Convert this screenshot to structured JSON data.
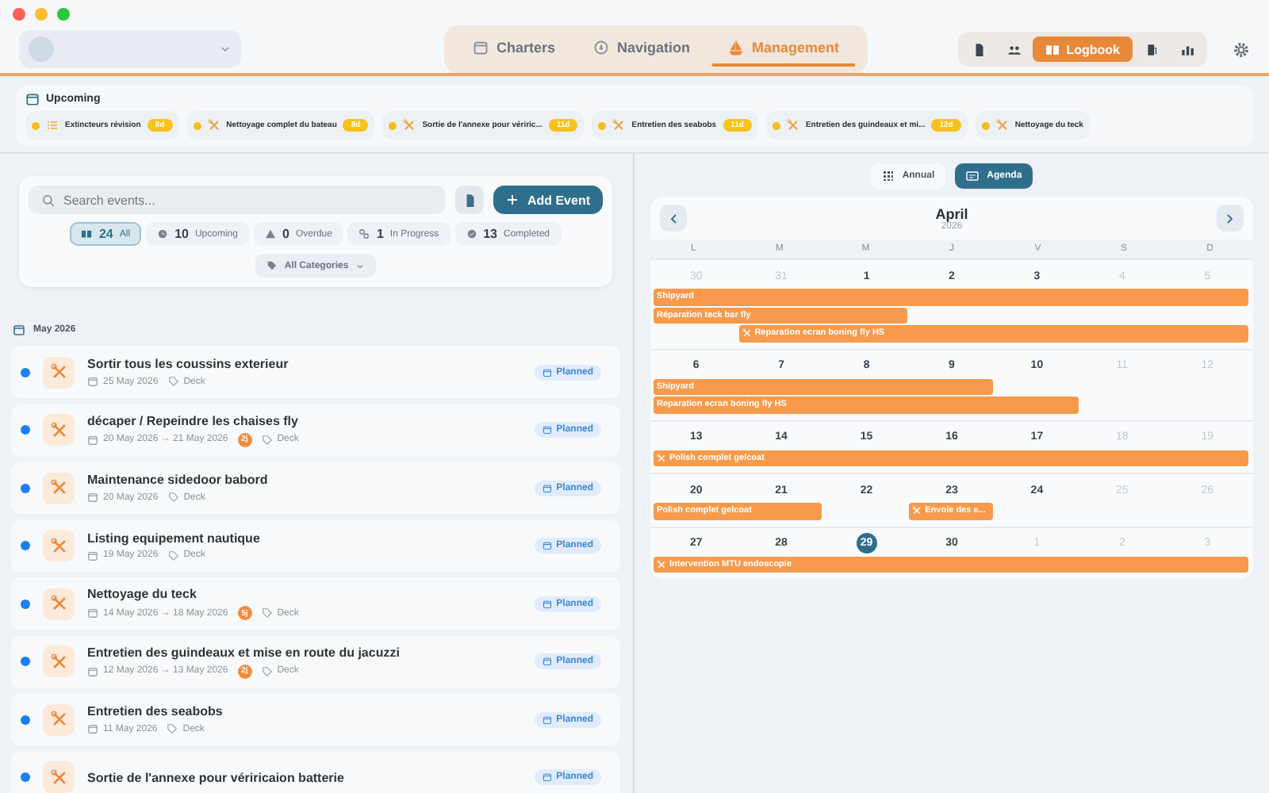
{
  "top_nav": {
    "tabs": [
      {
        "label": "Charters",
        "selected": false
      },
      {
        "label": "Navigation",
        "selected": false
      },
      {
        "label": "Management",
        "selected": true
      }
    ],
    "tools": [
      {
        "kind": "icon",
        "selected": false
      },
      {
        "kind": "icon",
        "selected": false
      },
      {
        "kind": "label",
        "label": "Logbook",
        "selected": true
      },
      {
        "kind": "icon",
        "selected": false
      },
      {
        "kind": "icon",
        "selected": false
      }
    ]
  },
  "upcoming": {
    "title": "Upcoming",
    "items": [
      {
        "kind": "checklist",
        "title": "Extincteurs révision",
        "days": "8d"
      },
      {
        "kind": "maintenance",
        "title": "Nettoyage complet du bateau",
        "days": "8d"
      },
      {
        "kind": "maintenance",
        "title": "Sortie de l'annexe pour vériric...",
        "days": "11d"
      },
      {
        "kind": "maintenance",
        "title": "Entretien des seabobs",
        "days": "11d"
      },
      {
        "kind": "maintenance",
        "title": "Entretien des guindeaux et mi...",
        "days": "12d"
      },
      {
        "kind": "maintenance",
        "title": "Nettoyage du teck"
      }
    ]
  },
  "search": {
    "placeholder": "Search events..."
  },
  "add_button": "Add Event",
  "filters": [
    {
      "count": "24",
      "label": "All",
      "selected": true
    },
    {
      "count": "10",
      "label": "Upcoming",
      "selected": false
    },
    {
      "count": "0",
      "label": "Overdue",
      "selected": false
    },
    {
      "count": "1",
      "label": "In Progress",
      "selected": false
    },
    {
      "count": "13",
      "label": "Completed",
      "selected": false
    }
  ],
  "category_filter": "All Categories",
  "month_heading": "May 2026",
  "events": [
    {
      "title": "Sortir tous les coussins exterieur",
      "date": "25 May 2026",
      "category": "Deck",
      "status": "Planned"
    },
    {
      "title": "décaper / Repeindre les chaises fly",
      "date": "20 May 2026 → 21 May 2026",
      "duration": "2j",
      "category": "Deck",
      "status": "Planned"
    },
    {
      "title": "Maintenance sidedoor babord",
      "date": "20 May 2026",
      "category": "Deck",
      "status": "Planned"
    },
    {
      "title": "Listing equipement nautique",
      "date": "19 May 2026",
      "category": "Deck",
      "status": "Planned"
    },
    {
      "title": "Nettoyage du teck",
      "date": "14 May 2026 → 18 May 2026",
      "duration": "5j",
      "category": "Deck",
      "status": "Planned"
    },
    {
      "title": "Entretien des guindeaux et mise en route du jacuzzi",
      "date": "12 May 2026 → 13 May 2026",
      "duration": "2j",
      "category": "Deck",
      "status": "Planned"
    },
    {
      "title": "Entretien des seabobs",
      "date": "11 May 2026",
      "category": "Deck",
      "status": "Planned"
    },
    {
      "title": "Sortie de l'annexe pour vériricaion batterie",
      "status": "Planned"
    }
  ],
  "view_toggle": [
    {
      "label": "Annual",
      "selected": false
    },
    {
      "label": "Agenda",
      "selected": true
    }
  ],
  "calendar": {
    "month": "April",
    "year": "2026",
    "weekdays": [
      "L",
      "M",
      "M",
      "J",
      "V",
      "S",
      "D"
    ],
    "weeks": [
      {
        "days": [
          {
            "label": "30",
            "muted": true,
            "today": false
          },
          {
            "label": "31",
            "muted": true,
            "today": false
          },
          {
            "label": "1",
            "muted": false,
            "today": false
          },
          {
            "label": "2",
            "muted": false,
            "today": false
          },
          {
            "label": "3",
            "muted": false,
            "today": false
          },
          {
            "label": "4",
            "muted": true,
            "today": false
          },
          {
            "label": "5",
            "muted": true,
            "today": false
          }
        ],
        "lanes": [
          [
            {
              "filled": true,
              "title": "Shipyard",
              "icon": false
            },
            {
              "filled": true
            },
            {
              "filled": true
            },
            {
              "filled": true
            },
            {
              "filled": true
            },
            {
              "filled": true
            },
            {
              "filled": true
            }
          ],
          [
            {
              "filled": true,
              "title": "Réparation teck bar fly",
              "icon": false
            },
            {
              "filled": true
            },
            {
              "filled": true
            },
            {
              "filled": false
            },
            {
              "filled": false
            },
            {
              "filled": false
            },
            {
              "filled": false
            }
          ],
          [
            {
              "filled": false
            },
            {
              "filled": true,
              "title": "Reparation ecran boning fly HS",
              "icon": true
            },
            {
              "filled": true
            },
            {
              "filled": true
            },
            {
              "filled": true
            },
            {
              "filled": true
            },
            {
              "filled": true
            }
          ]
        ]
      },
      {
        "days": [
          {
            "label": "6",
            "muted": false,
            "today": false
          },
          {
            "label": "7",
            "muted": false,
            "today": false
          },
          {
            "label": "8",
            "muted": false,
            "today": false
          },
          {
            "label": "9",
            "muted": false,
            "today": false
          },
          {
            "label": "10",
            "muted": false,
            "today": false
          },
          {
            "label": "11",
            "muted": true,
            "today": false
          },
          {
            "label": "12",
            "muted": true,
            "today": false
          }
        ],
        "lanes": [
          [
            {
              "filled": true,
              "title": "Shipyard",
              "icon": false
            },
            {
              "filled": true
            },
            {
              "filled": true
            },
            {
              "filled": true
            },
            {
              "filled": false
            },
            {
              "filled": false
            },
            {
              "filled": false
            }
          ],
          [
            {
              "filled": true,
              "title": "Reparation ecran boning fly HS",
              "icon": false
            },
            {
              "filled": true
            },
            {
              "filled": true
            },
            {
              "filled": true
            },
            {
              "filled": true
            },
            {
              "filled": false
            },
            {
              "filled": false
            }
          ]
        ]
      },
      {
        "days": [
          {
            "label": "13",
            "muted": false,
            "today": false
          },
          {
            "label": "14",
            "muted": false,
            "today": false
          },
          {
            "label": "15",
            "muted": false,
            "today": false
          },
          {
            "label": "16",
            "muted": false,
            "today": false
          },
          {
            "label": "17",
            "muted": false,
            "today": false
          },
          {
            "label": "18",
            "muted": true,
            "today": false
          },
          {
            "label": "19",
            "muted": true,
            "today": false
          }
        ],
        "lanes": [
          [
            {
              "filled": true,
              "title": "Polish complet gelcoat",
              "icon": true
            },
            {
              "filled": true
            },
            {
              "filled": true
            },
            {
              "filled": true
            },
            {
              "filled": true
            },
            {
              "filled": true
            },
            {
              "filled": true
            }
          ]
        ]
      },
      {
        "days": [
          {
            "label": "20",
            "muted": false,
            "today": false
          },
          {
            "label": "21",
            "muted": false,
            "today": false
          },
          {
            "label": "22",
            "muted": false,
            "today": false
          },
          {
            "label": "23",
            "muted": false,
            "today": false
          },
          {
            "label": "24",
            "muted": false,
            "today": false
          },
          {
            "label": "25",
            "muted": true,
            "today": false
          },
          {
            "label": "26",
            "muted": true,
            "today": false
          }
        ],
        "lanes": [
          [
            {
              "filled": true,
              "title": "Polish complet gelcoat",
              "icon": false
            },
            {
              "filled": true
            },
            {
              "filled": false
            },
            {
              "filled": true,
              "title": "Envoie des e...",
              "icon": true
            },
            {
              "filled": false
            },
            {
              "filled": false
            },
            {
              "filled": false
            }
          ]
        ]
      },
      {
        "days": [
          {
            "label": "27",
            "muted": false,
            "today": false
          },
          {
            "label": "28",
            "muted": false,
            "today": false
          },
          {
            "label": "29",
            "muted": false,
            "today": true
          },
          {
            "label": "30",
            "muted": false,
            "today": false
          },
          {
            "label": "1",
            "muted": true,
            "today": false
          },
          {
            "label": "2",
            "muted": true,
            "today": false
          },
          {
            "label": "3",
            "muted": true,
            "today": false
          }
        ],
        "lanes": [
          [
            {
              "filled": true,
              "title": "Intervention MTU endoscopie",
              "icon": true
            },
            {
              "filled": true
            },
            {
              "filled": true
            },
            {
              "filled": true
            },
            {
              "filled": true
            },
            {
              "filled": true
            },
            {
              "filled": true
            }
          ]
        ]
      }
    ]
  }
}
